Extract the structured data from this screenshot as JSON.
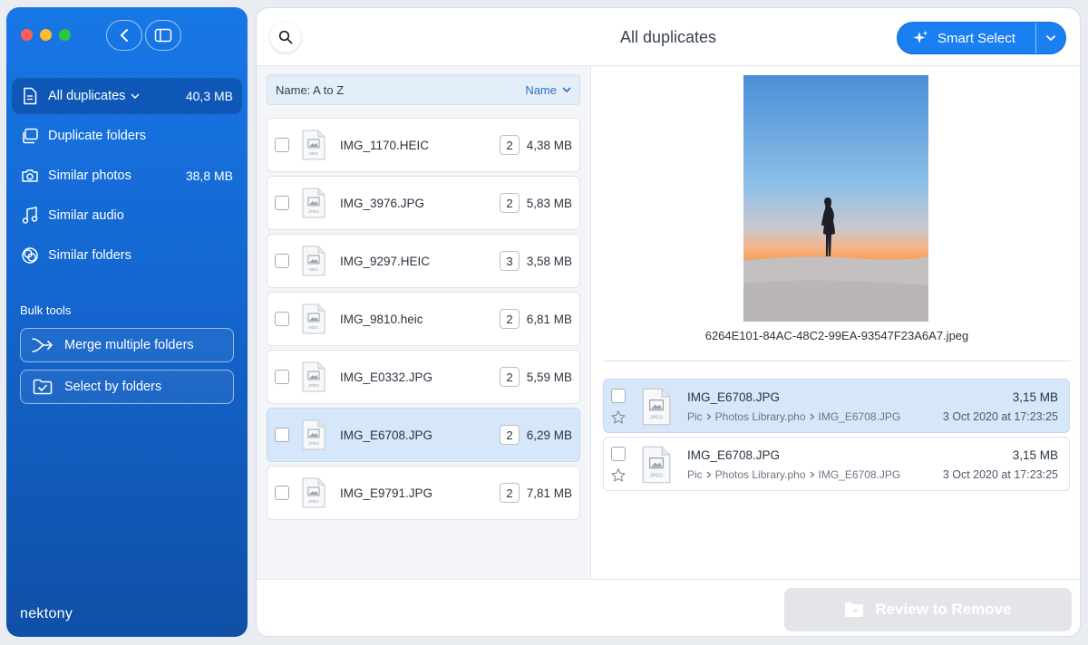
{
  "sidebar": {
    "items": [
      {
        "label": "All duplicates",
        "size": "40,3 MB",
        "icon": "document-icon"
      },
      {
        "label": "Duplicate folders",
        "size": "",
        "icon": "folders-icon"
      },
      {
        "label": "Similar photos",
        "size": "38,8 MB",
        "icon": "camera-icon"
      },
      {
        "label": "Similar audio",
        "size": "",
        "icon": "music-note-icon"
      },
      {
        "label": "Similar folders",
        "size": "",
        "icon": "similar-folders-icon"
      }
    ],
    "bulk_title": "Bulk tools",
    "bulk_tools": [
      {
        "label": "Merge multiple folders",
        "icon": "merge-arrow-icon"
      },
      {
        "label": "Select by folders",
        "icon": "folder-check-icon"
      }
    ],
    "logo": "nektony"
  },
  "header": {
    "title": "All duplicates",
    "smart_select_label": "Smart Select"
  },
  "sort": {
    "label": "Name: A to Z",
    "field": "Name"
  },
  "files": [
    {
      "name": "IMG_1170.HEIC",
      "type": "HEIC",
      "count": "2",
      "size": "4,38 MB",
      "selected": false
    },
    {
      "name": "IMG_3976.JPG",
      "type": "JPEG",
      "count": "2",
      "size": "5,83 MB",
      "selected": false
    },
    {
      "name": "IMG_9297.HEIC",
      "type": "HEIC",
      "count": "3",
      "size": "3,58 MB",
      "selected": false
    },
    {
      "name": "IMG_9810.heic",
      "type": "HEIC",
      "count": "2",
      "size": "6,81 MB",
      "selected": false
    },
    {
      "name": "IMG_E0332.JPG",
      "type": "JPEG",
      "count": "2",
      "size": "5,59 MB",
      "selected": false
    },
    {
      "name": "IMG_E6708.JPG",
      "type": "JPEG",
      "count": "2",
      "size": "6,29 MB",
      "selected": true
    },
    {
      "name": "IMG_E9791.JPG",
      "type": "JPEG",
      "count": "2",
      "size": "7,81 MB",
      "selected": false
    }
  ],
  "preview": {
    "filename": "6264E101-84AC-48C2-99EA-93547F23A6A7.jpeg",
    "duplicates": [
      {
        "name": "IMG_E6708.JPG",
        "size": "3,15 MB",
        "path": [
          "Pic",
          "Photos Library.pho",
          "IMG_E6708.JPG"
        ],
        "date": "3 Oct 2020 at 17:23:25",
        "type": "JPEG",
        "selected": true
      },
      {
        "name": "IMG_E6708.JPG",
        "size": "3,15 MB",
        "path": [
          "Pic",
          "Photos Library.pho",
          "IMG_E6708.JPG"
        ],
        "date": "3 Oct 2020 at 17:23:25",
        "type": "JPEG",
        "selected": false
      }
    ]
  },
  "footer": {
    "review_label": "Review to Remove"
  }
}
